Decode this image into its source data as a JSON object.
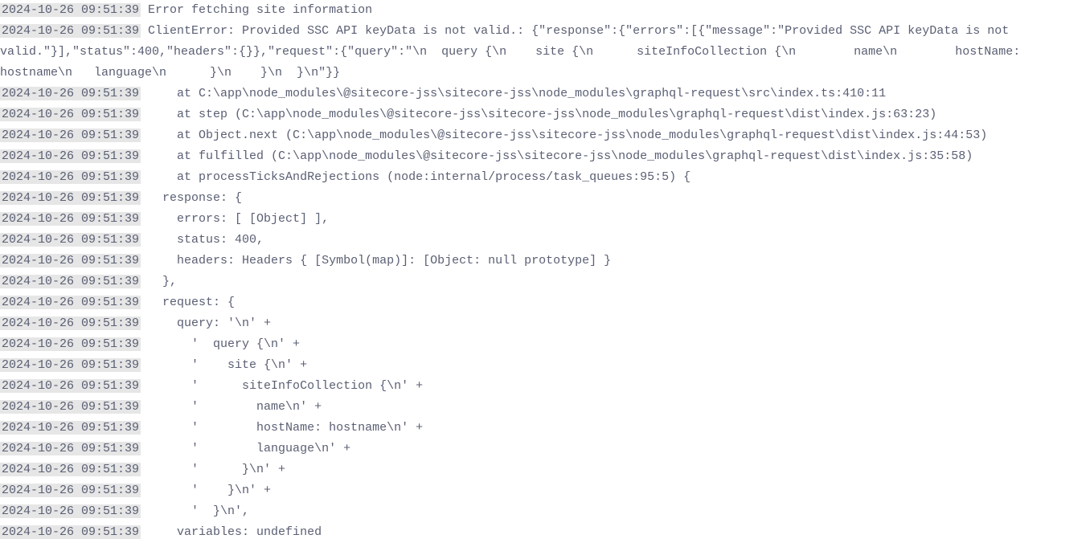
{
  "log": {
    "lines": [
      {
        "ts": "2024-10-26 09:51:39",
        "msg": " Error fetching site information"
      },
      {
        "ts": "2024-10-26 09:51:39",
        "msg": " ClientError: Provided SSC API keyData is not valid.: {\"response\":{\"errors\":[{\"message\":\"Provided SSC API keyData is not valid.\"}],\"status\":400,\"headers\":{}},\"request\":{\"query\":\"\\n  query {\\n    site {\\n      siteInfoCollection {\\n        name\\n        hostName: hostname\\n   language\\n      }\\n    }\\n  }\\n\"}}"
      },
      {
        "ts": "2024-10-26 09:51:39",
        "msg": "     at C:\\app\\node_modules\\@sitecore-jss\\sitecore-jss\\node_modules\\graphql-request\\src\\index.ts:410:11"
      },
      {
        "ts": "2024-10-26 09:51:39",
        "msg": "     at step (C:\\app\\node_modules\\@sitecore-jss\\sitecore-jss\\node_modules\\graphql-request\\dist\\index.js:63:23)"
      },
      {
        "ts": "2024-10-26 09:51:39",
        "msg": "     at Object.next (C:\\app\\node_modules\\@sitecore-jss\\sitecore-jss\\node_modules\\graphql-request\\dist\\index.js:44:53)"
      },
      {
        "ts": "2024-10-26 09:51:39",
        "msg": "     at fulfilled (C:\\app\\node_modules\\@sitecore-jss\\sitecore-jss\\node_modules\\graphql-request\\dist\\index.js:35:58)"
      },
      {
        "ts": "2024-10-26 09:51:39",
        "msg": "     at processTicksAndRejections (node:internal/process/task_queues:95:5) {"
      },
      {
        "ts": "2024-10-26 09:51:39",
        "msg": "   response: {"
      },
      {
        "ts": "2024-10-26 09:51:39",
        "msg": "     errors: [ [Object] ],"
      },
      {
        "ts": "2024-10-26 09:51:39",
        "msg": "     status: 400,"
      },
      {
        "ts": "2024-10-26 09:51:39",
        "msg": "     headers: Headers { [Symbol(map)]: [Object: null prototype] }"
      },
      {
        "ts": "2024-10-26 09:51:39",
        "msg": "   },"
      },
      {
        "ts": "2024-10-26 09:51:39",
        "msg": "   request: {"
      },
      {
        "ts": "2024-10-26 09:51:39",
        "msg": "     query: '\\n' +"
      },
      {
        "ts": "2024-10-26 09:51:39",
        "msg": "       '  query {\\n' +"
      },
      {
        "ts": "2024-10-26 09:51:39",
        "msg": "       '    site {\\n' +"
      },
      {
        "ts": "2024-10-26 09:51:39",
        "msg": "       '      siteInfoCollection {\\n' +"
      },
      {
        "ts": "2024-10-26 09:51:39",
        "msg": "       '        name\\n' +"
      },
      {
        "ts": "2024-10-26 09:51:39",
        "msg": "       '        hostName: hostname\\n' +"
      },
      {
        "ts": "2024-10-26 09:51:39",
        "msg": "       '        language\\n' +"
      },
      {
        "ts": "2024-10-26 09:51:39",
        "msg": "       '      }\\n' +"
      },
      {
        "ts": "2024-10-26 09:51:39",
        "msg": "       '    }\\n' +"
      },
      {
        "ts": "2024-10-26 09:51:39",
        "msg": "       '  }\\n',"
      },
      {
        "ts": "2024-10-26 09:51:39",
        "msg": "     variables: undefined"
      }
    ]
  }
}
